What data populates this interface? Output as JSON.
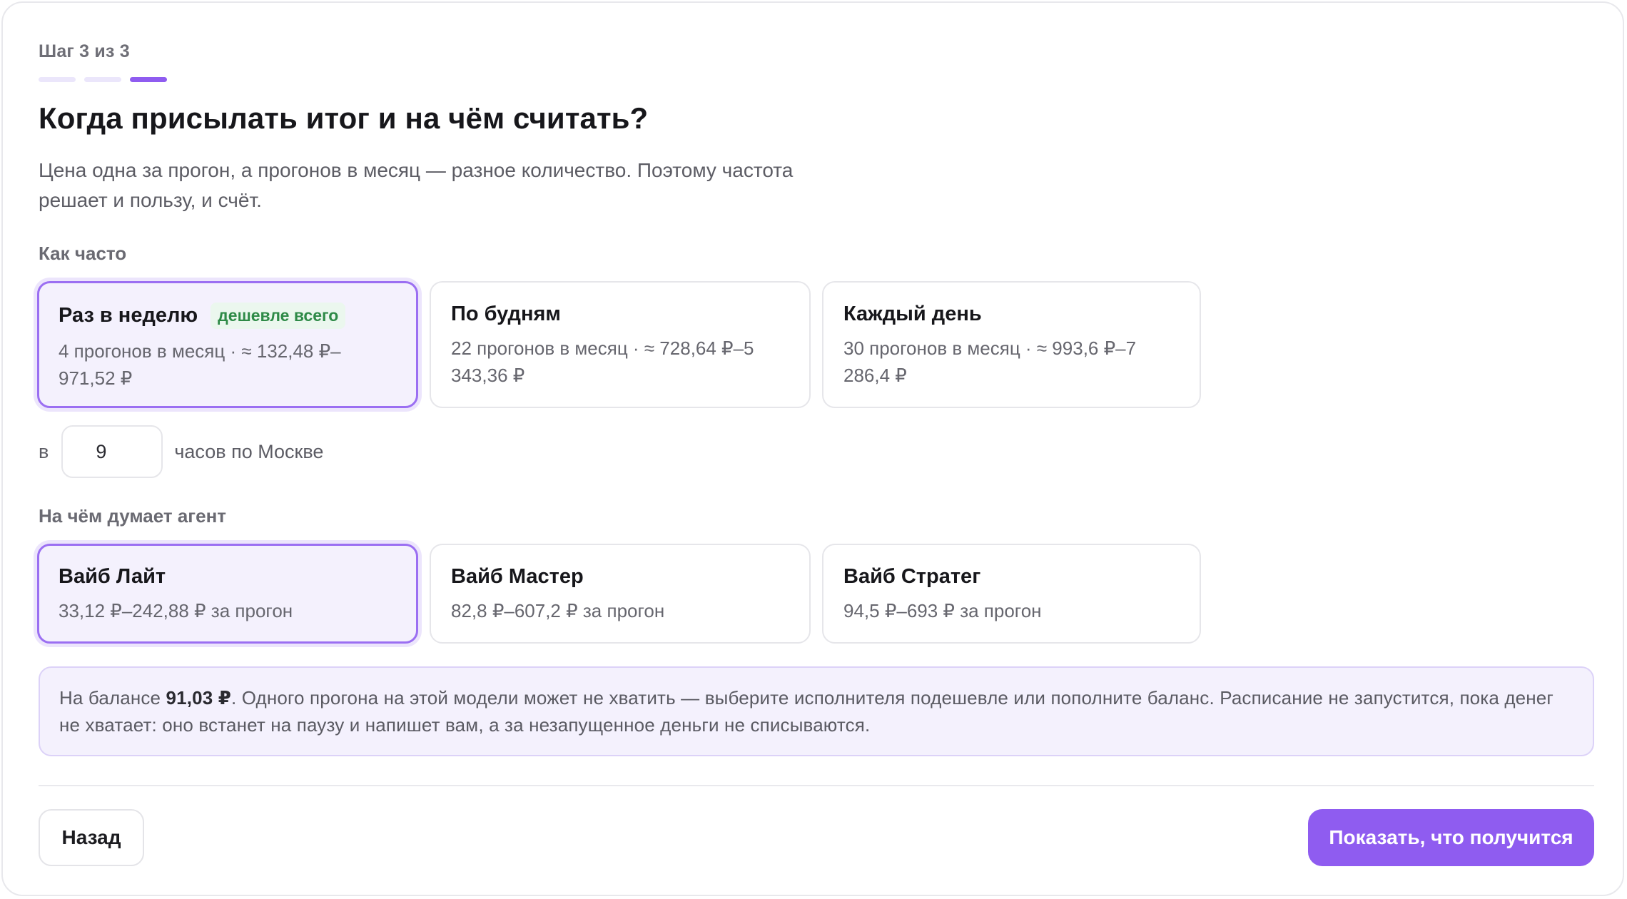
{
  "header": {
    "step_label": "Шаг 3 из 3",
    "steps_total": 3,
    "current_step": 3,
    "title": "Когда присылать итог и на чём считать?",
    "subtitle": "Цена одна за прогон, а прогонов в месяц — разное количество. Поэтому частота решает и пользу, и счёт."
  },
  "frequency": {
    "label": "Как часто",
    "selected": "weekly",
    "options": [
      {
        "name": "Раз в неделю",
        "badge": "дешевле всего",
        "desc": "4 прогонов в месяц · ≈ 132,48 ₽–971,52 ₽"
      },
      {
        "name": "По будням",
        "desc": "22 прогонов в месяц · ≈ 728,64 ₽–5 343,36 ₽"
      },
      {
        "name": "Каждый день",
        "desc": "30 прогонов в месяц · ≈ 993,6 ₽–7 286,4 ₽"
      }
    ]
  },
  "time": {
    "prefix": "в",
    "value": "9",
    "suffix": "часов по Москве"
  },
  "model": {
    "label": "На чём думает агент",
    "selected": "lite",
    "options": [
      {
        "name": "Вайб Лайт",
        "desc": "33,12 ₽–242,88 ₽ за прогон"
      },
      {
        "name": "Вайб Мастер",
        "desc": "82,8 ₽–607,2 ₽ за прогон"
      },
      {
        "name": "Вайб Стратег",
        "desc": "94,5 ₽–693 ₽ за прогон"
      }
    ]
  },
  "notice": {
    "prefix": "На балансе ",
    "balance": "91,03 ₽",
    "text": ". Одного прогона на этой модели может не хватить — выберите исполнителя подешевле или пополните баланс. Расписание не запустится, пока денег не хватает: оно встанет на паузу и напишет вам, а за незапущенное деньги не списываются."
  },
  "footer": {
    "back_label": "Назад",
    "primary_label": "Показать, что получится"
  },
  "colors": {
    "accent": "#8f5cf0",
    "selected_bg": "#f4f1fd",
    "badge_green": "#2e8a47"
  }
}
